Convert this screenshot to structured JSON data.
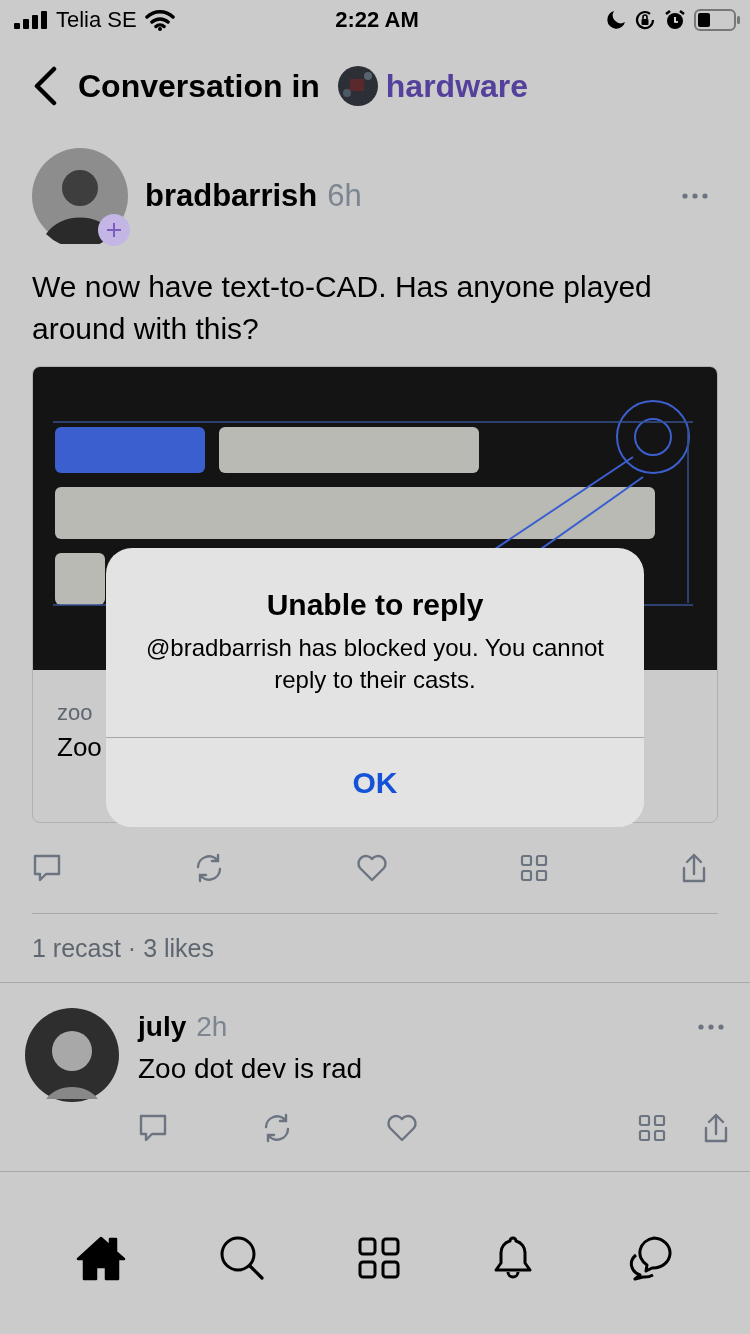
{
  "status_bar": {
    "carrier": "Telia SE",
    "time": "2:22 AM"
  },
  "header": {
    "title": "Conversation in",
    "channel": "hardware"
  },
  "post": {
    "author": "bradbarrish",
    "time": "6h",
    "text": "We now have text-to-CAD. Has anyone played around with this?",
    "link_preview": {
      "domain": "zoo",
      "title": "Zoo"
    },
    "stats": "1 recast · 3 likes"
  },
  "reply": {
    "author": "july",
    "time": "2h",
    "text": "Zoo dot dev is rad"
  },
  "dialog": {
    "title": "Unable to reply",
    "message": "@bradbarrish has blocked you. You cannot reply to their casts.",
    "button": "OK"
  },
  "tab_bar": [
    {
      "kind": "home",
      "selected": true
    },
    {
      "kind": "search",
      "selected": false
    },
    {
      "kind": "apps",
      "selected": false
    },
    {
      "kind": "notifications",
      "selected": false
    },
    {
      "kind": "messages",
      "selected": false
    }
  ]
}
